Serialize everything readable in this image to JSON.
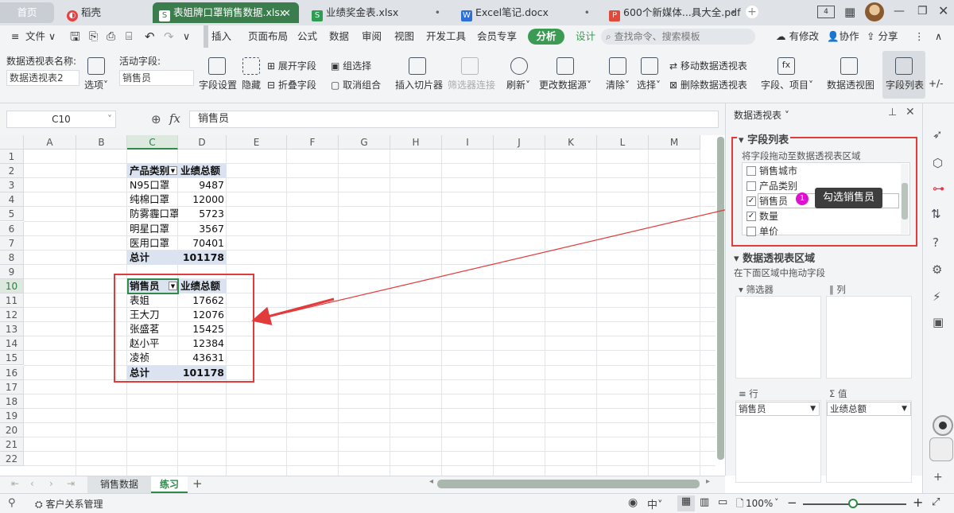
{
  "tabs": {
    "home": "首页",
    "daoke": "稻壳",
    "file1": "表姐牌口罩销售数据.xlsx",
    "file2": "业绩奖金表.xlsx",
    "file3": "Excel笔记.docx",
    "file4": "600个新媒体...具大全.pdf"
  },
  "menu": {
    "file": "文件",
    "insert": "插入",
    "layout": "页面布局",
    "formula": "公式",
    "data": "数据",
    "review": "审阅",
    "view": "视图",
    "dev": "开发工具",
    "vip": "会员专享",
    "analyze": "分析",
    "design": "设计",
    "search_placeholder": "查找命令、搜索模板",
    "changes": "有修改",
    "collab": "协作",
    "share": "分享"
  },
  "ribbon": {
    "pt_name_label": "数据透视表名称:",
    "pt_name_value": "数据透视表2",
    "options": "选项",
    "active_field_label": "活动字段:",
    "active_field_value": "销售员",
    "field_settings": "字段设置",
    "hide": "隐藏",
    "expand": "展开字段",
    "collapse": "折叠字段",
    "group_select": "组选择",
    "ungroup": "取消组合",
    "insert_slicer": "插入切片器",
    "filter_conn": "筛选器连接",
    "refresh": "刷新",
    "change_source": "更改数据源",
    "clear": "清除",
    "select": "选择",
    "move_pt": "移动数据透视表",
    "delete_pt": "删除数据透视表",
    "fields_items": "字段、项目",
    "pivot_view": "数据透视图",
    "field_list": "字段列表",
    "plus_minus": "+/-"
  },
  "formula": {
    "cell_ref": "C10",
    "fx": "fx",
    "value": "销售员"
  },
  "columns": [
    "A",
    "B",
    "C",
    "D",
    "E",
    "F",
    "G",
    "H",
    "I",
    "J",
    "K",
    "L",
    "M"
  ],
  "rows": [
    "1",
    "2",
    "3",
    "4",
    "5",
    "6",
    "7",
    "8",
    "9",
    "10",
    "11",
    "12",
    "13",
    "14",
    "15",
    "16",
    "17",
    "18",
    "19",
    "20",
    "21",
    "22"
  ],
  "table1": {
    "header": [
      "产品类别",
      "业绩总额"
    ],
    "rows": [
      [
        "N95口罩",
        "9487"
      ],
      [
        "纯棉口罩",
        "12000"
      ],
      [
        "防雾霾口罩",
        "5723"
      ],
      [
        "明星口罩",
        "3567"
      ],
      [
        "医用口罩",
        "70401"
      ]
    ],
    "total": [
      "总计",
      "101178"
    ]
  },
  "table2": {
    "header": [
      "销售员",
      "业绩总额"
    ],
    "rows": [
      [
        "表姐",
        "17662"
      ],
      [
        "王大刀",
        "12076"
      ],
      [
        "张盛茗",
        "15425"
      ],
      [
        "赵小平",
        "12384"
      ],
      [
        "凌祯",
        "43631"
      ]
    ],
    "total": [
      "总计",
      "101178"
    ]
  },
  "panel": {
    "title": "数据透视表",
    "field_list": "字段列表",
    "drag_hint": "将字段拖动至数据透视表区域",
    "fields": [
      {
        "name": "销售城市",
        "checked": false
      },
      {
        "name": "产品类别",
        "checked": false
      },
      {
        "name": "销售员",
        "checked": true
      },
      {
        "name": "数量",
        "checked": true
      },
      {
        "name": "单价",
        "checked": false
      }
    ],
    "callout_num": "1",
    "callout_text": "勾选销售员",
    "area_title": "数据透视表区域",
    "area_hint": "在下面区域中拖动字段",
    "filter": "筛选器",
    "columns": "列",
    "rows": "行",
    "values": "值",
    "row_field": "销售员",
    "value_field": "业绩总额"
  },
  "sheets": {
    "sheet1": "销售数据",
    "sheet2": "练习"
  },
  "status": {
    "crm": "客户关系管理",
    "zoom": "100%"
  },
  "colors": {
    "accent": "#3b9b52",
    "red": "#e23b3b"
  }
}
